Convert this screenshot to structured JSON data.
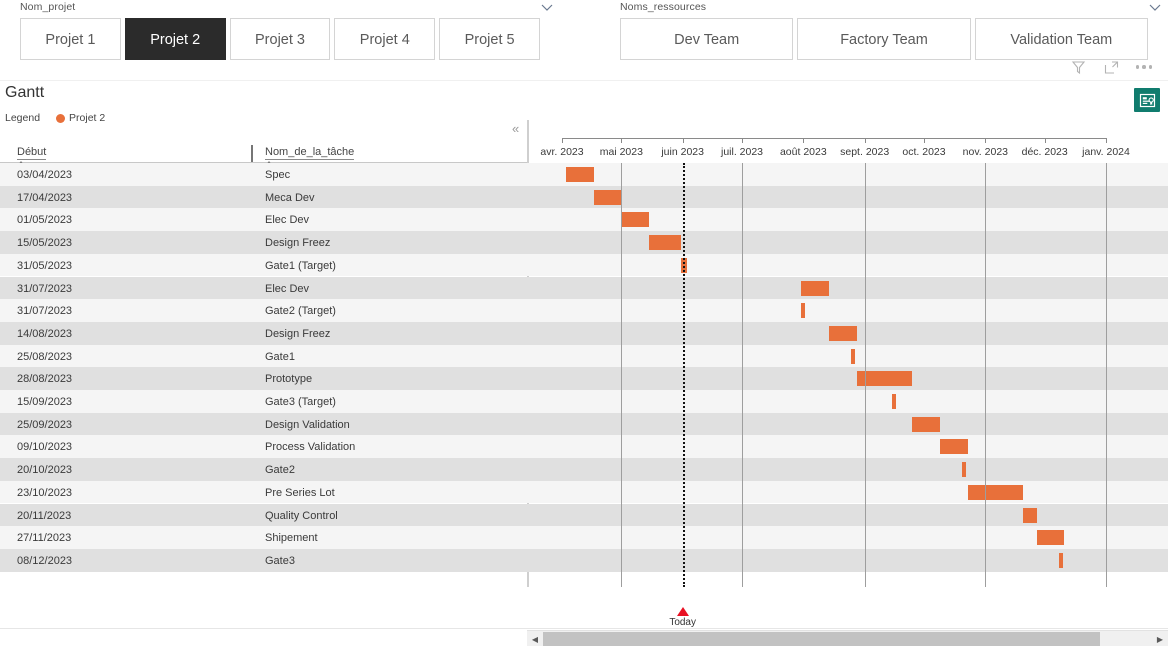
{
  "slicers": [
    {
      "name": "Nom_projet",
      "label": "Nom_projet",
      "items": [
        {
          "label": "Projet 1",
          "selected": false
        },
        {
          "label": "Projet 2",
          "selected": true
        },
        {
          "label": "Projet 3",
          "selected": false
        },
        {
          "label": "Projet 4",
          "selected": false
        },
        {
          "label": "Projet 5",
          "selected": false
        }
      ]
    },
    {
      "name": "Noms_ressources",
      "label": "Noms_ressources",
      "items": [
        {
          "label": "Dev Team",
          "selected": false
        },
        {
          "label": "Factory Team",
          "selected": false
        },
        {
          "label": "Validation Team",
          "selected": false
        }
      ]
    }
  ],
  "visual_header": {
    "filter_icon": "filter-icon",
    "focus_icon": "focus-mode-icon",
    "more_icon": "more-options-icon"
  },
  "visual": {
    "title": "Gantt",
    "legend_label": "Legend",
    "legend_items": [
      {
        "label": "Projet 2",
        "color": "#E8703A"
      }
    ],
    "certified_badge_color": "#107C6E",
    "collapse_label": "«"
  },
  "table": {
    "columns": [
      {
        "key": "debut",
        "label": "Début"
      },
      {
        "key": "tache",
        "label": "Nom_de_la_tâche"
      }
    ],
    "rows": [
      {
        "debut": "03/04/2023",
        "tache": "Spec",
        "start": "2023-04-03",
        "end": "2023-04-17"
      },
      {
        "debut": "17/04/2023",
        "tache": "Meca Dev",
        "start": "2023-04-17",
        "end": "2023-05-01"
      },
      {
        "debut": "01/05/2023",
        "tache": "Elec Dev",
        "start": "2023-05-01",
        "end": "2023-05-15"
      },
      {
        "debut": "15/05/2023",
        "tache": "Design Freez",
        "start": "2023-05-15",
        "end": "2023-05-31"
      },
      {
        "debut": "31/05/2023",
        "tache": "Gate1 (Target)",
        "start": "2023-05-31",
        "end": "2023-06-03"
      },
      {
        "debut": "31/07/2023",
        "tache": "Elec Dev",
        "start": "2023-07-31",
        "end": "2023-08-14"
      },
      {
        "debut": "31/07/2023",
        "tache": "Gate2 (Target)",
        "start": "2023-07-31",
        "end": "2023-08-02"
      },
      {
        "debut": "14/08/2023",
        "tache": "Design Freez",
        "start": "2023-08-14",
        "end": "2023-08-28"
      },
      {
        "debut": "25/08/2023",
        "tache": "Gate1",
        "start": "2023-08-25",
        "end": "2023-08-27"
      },
      {
        "debut": "28/08/2023",
        "tache": "Prototype",
        "start": "2023-08-28",
        "end": "2023-09-25"
      },
      {
        "debut": "15/09/2023",
        "tache": "Gate3 (Target)",
        "start": "2023-09-15",
        "end": "2023-09-17"
      },
      {
        "debut": "25/09/2023",
        "tache": "Design Validation",
        "start": "2023-09-25",
        "end": "2023-10-09"
      },
      {
        "debut": "09/10/2023",
        "tache": "Process Validation",
        "start": "2023-10-09",
        "end": "2023-10-23"
      },
      {
        "debut": "20/10/2023",
        "tache": "Gate2",
        "start": "2023-10-20",
        "end": "2023-10-22"
      },
      {
        "debut": "23/10/2023",
        "tache": "Pre Series Lot",
        "start": "2023-10-23",
        "end": "2023-11-20"
      },
      {
        "debut": "20/11/2023",
        "tache": "Quality Control",
        "start": "2023-11-20",
        "end": "2023-11-27"
      },
      {
        "debut": "27/11/2023",
        "tache": "Shipement",
        "start": "2023-11-27",
        "end": "2023-12-11"
      },
      {
        "debut": "08/12/2023",
        "tache": "Gate3",
        "start": "2023-12-08",
        "end": "2023-12-10"
      }
    ]
  },
  "chart_data": {
    "type": "bar",
    "title": "Gantt",
    "orientation": "horizontal-timeline",
    "bar_color": "#E8703A",
    "axis_start": "2023-04-01",
    "axis_end": "2024-01-01",
    "axis_ticks": [
      {
        "label": "avr. 2023",
        "date": "2023-04-01"
      },
      {
        "label": "mai 2023",
        "date": "2023-05-01"
      },
      {
        "label": "juin 2023",
        "date": "2023-06-01"
      },
      {
        "label": "juil. 2023",
        "date": "2023-07-01"
      },
      {
        "label": "août 2023",
        "date": "2023-08-01"
      },
      {
        "label": "sept. 2023",
        "date": "2023-09-01"
      },
      {
        "label": "oct. 2023",
        "date": "2023-10-01"
      },
      {
        "label": "nov. 2023",
        "date": "2023-11-01"
      },
      {
        "label": "déc. 2023",
        "date": "2023-12-01"
      },
      {
        "label": "janv. 2024",
        "date": "2024-01-01"
      }
    ],
    "gridline_dates": [
      "2023-05-01",
      "2023-07-01",
      "2023-09-01",
      "2023-11-01",
      "2024-01-01"
    ],
    "today": {
      "date": "2023-06-01",
      "label": "Today",
      "color": "#e81123"
    },
    "categories": [
      "Spec",
      "Meca Dev",
      "Elec Dev",
      "Design Freez",
      "Gate1 (Target)",
      "Elec Dev",
      "Gate2 (Target)",
      "Design Freez",
      "Gate1",
      "Prototype",
      "Gate3 (Target)",
      "Design Validation",
      "Process Validation",
      "Gate2",
      "Pre Series Lot",
      "Quality Control",
      "Shipement",
      "Gate3"
    ],
    "tasks": [
      {
        "name": "Spec",
        "start": "2023-04-03",
        "end": "2023-04-17",
        "duration_days": 14
      },
      {
        "name": "Meca Dev",
        "start": "2023-04-17",
        "end": "2023-05-01",
        "duration_days": 14
      },
      {
        "name": "Elec Dev",
        "start": "2023-05-01",
        "end": "2023-05-15",
        "duration_days": 14
      },
      {
        "name": "Design Freez",
        "start": "2023-05-15",
        "end": "2023-05-31",
        "duration_days": 16
      },
      {
        "name": "Gate1 (Target)",
        "start": "2023-05-31",
        "end": "2023-06-03",
        "duration_days": 3
      },
      {
        "name": "Elec Dev",
        "start": "2023-07-31",
        "end": "2023-08-14",
        "duration_days": 14
      },
      {
        "name": "Gate2 (Target)",
        "start": "2023-07-31",
        "end": "2023-08-02",
        "duration_days": 2
      },
      {
        "name": "Design Freez",
        "start": "2023-08-14",
        "end": "2023-08-28",
        "duration_days": 14
      },
      {
        "name": "Gate1",
        "start": "2023-08-25",
        "end": "2023-08-27",
        "duration_days": 2
      },
      {
        "name": "Prototype",
        "start": "2023-08-28",
        "end": "2023-09-25",
        "duration_days": 28
      },
      {
        "name": "Gate3 (Target)",
        "start": "2023-09-15",
        "end": "2023-09-17",
        "duration_days": 2
      },
      {
        "name": "Design Validation",
        "start": "2023-09-25",
        "end": "2023-10-09",
        "duration_days": 14
      },
      {
        "name": "Process Validation",
        "start": "2023-10-09",
        "end": "2023-10-23",
        "duration_days": 14
      },
      {
        "name": "Gate2",
        "start": "2023-10-20",
        "end": "2023-10-22",
        "duration_days": 2
      },
      {
        "name": "Pre Series Lot",
        "start": "2023-10-23",
        "end": "2023-11-20",
        "duration_days": 28
      },
      {
        "name": "Quality Control",
        "start": "2023-11-20",
        "end": "2023-11-27",
        "duration_days": 7
      },
      {
        "name": "Shipement",
        "start": "2023-11-27",
        "end": "2023-12-11",
        "duration_days": 14
      },
      {
        "name": "Gate3",
        "start": "2023-12-08",
        "end": "2023-12-10",
        "duration_days": 2
      }
    ]
  },
  "scrollbar": {
    "left_arrow": "◀",
    "right_arrow": "▶"
  }
}
